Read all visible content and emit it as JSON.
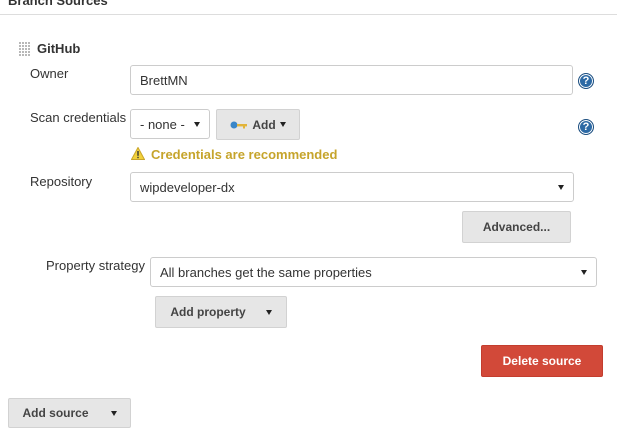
{
  "section": {
    "title": "Branch Sources"
  },
  "source": {
    "title": "GitHub",
    "owner_label": "Owner",
    "owner_value": "BrettMN",
    "scan_credentials_label": "Scan credentials",
    "scan_credentials_selected": "- none -",
    "add_button_label": "Add",
    "warning_text": "Credentials are recommended",
    "repository_label": "Repository",
    "repository_selected": "wipdeveloper-dx",
    "advanced_button_label": "Advanced...",
    "property_strategy_label": "Property strategy",
    "property_strategy_selected": "All branches get the same properties",
    "add_property_button_label": "Add property",
    "delete_button_label": "Delete source",
    "help_icon_glyph": "?"
  },
  "footer": {
    "add_source_button_label": "Add source"
  },
  "colors": {
    "delete_button": "#d24939",
    "help_icon": "#2d6aa5",
    "warning_text": "#c6a42b",
    "warning_icon": "#f2d13a",
    "key_icon": "#3a86c8"
  },
  "icons": {
    "drag_handle": "drag-handle-icon",
    "help": "help-icon",
    "warning": "warning-icon",
    "key": "key-icon",
    "dropdown": "chevron-down-icon"
  }
}
